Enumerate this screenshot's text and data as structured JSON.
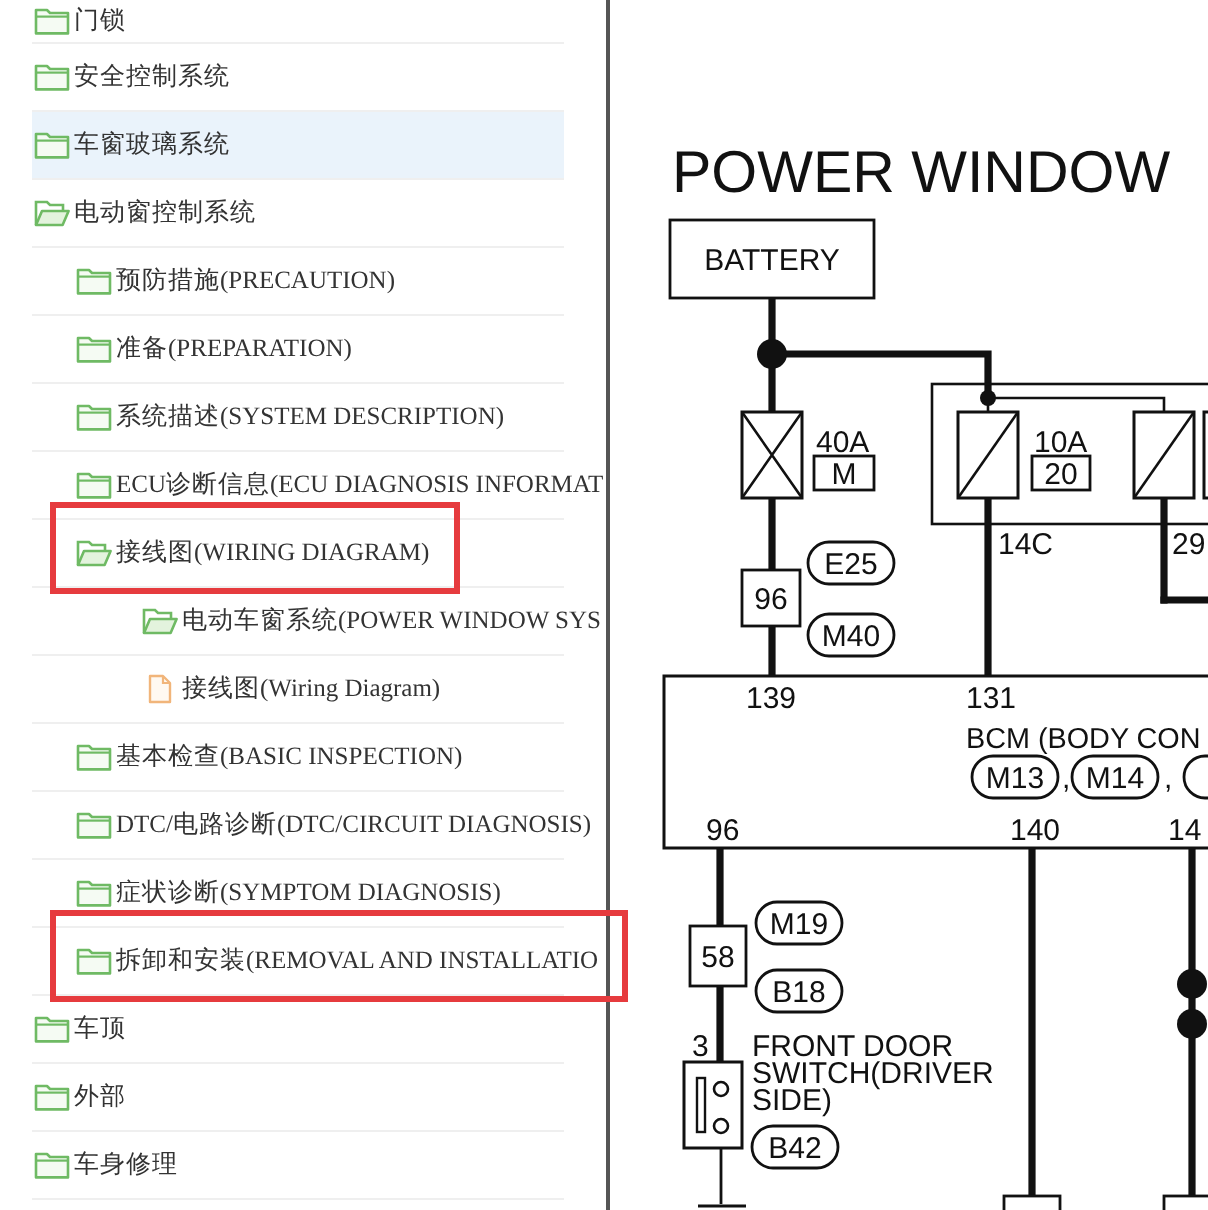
{
  "tree": {
    "items": [
      {
        "kind": "folder",
        "label": "门锁",
        "expanded": false,
        "selected": false,
        "outlined": false
      },
      {
        "kind": "folder",
        "label": "安全控制系统",
        "expanded": false,
        "selected": false,
        "outlined": false
      },
      {
        "kind": "folder",
        "label": "车窗玻璃系统",
        "expanded": false,
        "selected": true,
        "outlined": false
      },
      {
        "kind": "folder",
        "label": "电动窗控制系统",
        "expanded": true,
        "selected": false,
        "outlined": false,
        "children": [
          {
            "kind": "folder",
            "label": "预防措施(PRECAUTION)",
            "expanded": false,
            "selected": false,
            "outlined": false
          },
          {
            "kind": "folder",
            "label": "准备(PREPARATION)",
            "expanded": false,
            "selected": false,
            "outlined": false
          },
          {
            "kind": "folder",
            "label": "系统描述(SYSTEM DESCRIPTION)",
            "expanded": false,
            "selected": false,
            "outlined": false
          },
          {
            "kind": "folder",
            "label": "ECU诊断信息(ECU DIAGNOSIS INFORMAT",
            "expanded": false,
            "selected": false,
            "outlined": false
          },
          {
            "kind": "folder",
            "label": "接线图(WIRING DIAGRAM)",
            "expanded": true,
            "selected": false,
            "outlined": true,
            "children": [
              {
                "kind": "folder",
                "label": "电动车窗系统(POWER WINDOW SYS",
                "expanded": true,
                "selected": false,
                "outlined": false
              },
              {
                "kind": "file",
                "label": "接线图(Wiring Diagram)",
                "selected": false,
                "outlined": false
              }
            ]
          },
          {
            "kind": "folder",
            "label": "基本检查(BASIC INSPECTION)",
            "expanded": false,
            "selected": false,
            "outlined": false
          },
          {
            "kind": "folder",
            "label": "DTC/电路诊断(DTC/CIRCUIT DIAGNOSIS)",
            "expanded": false,
            "selected": false,
            "outlined": false
          },
          {
            "kind": "folder",
            "label": "症状诊断(SYMPTOM DIAGNOSIS)",
            "expanded": false,
            "selected": false,
            "outlined": false
          },
          {
            "kind": "folder",
            "label": "拆卸和安装(REMOVAL AND INSTALLATIO",
            "expanded": false,
            "selected": false,
            "outlined": true
          }
        ]
      },
      {
        "kind": "folder",
        "label": "车顶",
        "expanded": false,
        "selected": false,
        "outlined": false
      },
      {
        "kind": "folder",
        "label": "外部",
        "expanded": false,
        "selected": false,
        "outlined": false
      },
      {
        "kind": "folder",
        "label": "车身修理",
        "expanded": false,
        "selected": false,
        "outlined": false
      }
    ]
  },
  "diagram": {
    "title": "POWER WINDOW",
    "battery": "BATTERY",
    "fuses": [
      {
        "kind": "fusible_link",
        "rating": "40A",
        "location": "M"
      },
      {
        "kind": "fuse",
        "rating": "10A",
        "location": "20"
      }
    ],
    "fuse_block_terminals": [
      "14C",
      "29"
    ],
    "harness_connectors": [
      {
        "pin": "96",
        "codes": [
          "E25",
          "M40"
        ]
      },
      {
        "pin": "58",
        "codes": [
          "M19",
          "B18"
        ]
      }
    ],
    "bcm": {
      "top_pins": [
        "139",
        "131"
      ],
      "name": "BCM (BODY CON",
      "connectors": [
        "M13",
        "M14"
      ],
      "separators": [
        ",",
        ","
      ],
      "bottom_pins": [
        "96",
        "140",
        "14"
      ]
    },
    "switch": {
      "pin": "3",
      "label_lines": [
        "FRONT DOOR",
        "SWITCH(DRIVER",
        "SIDE)"
      ],
      "connector": "B42"
    }
  }
}
